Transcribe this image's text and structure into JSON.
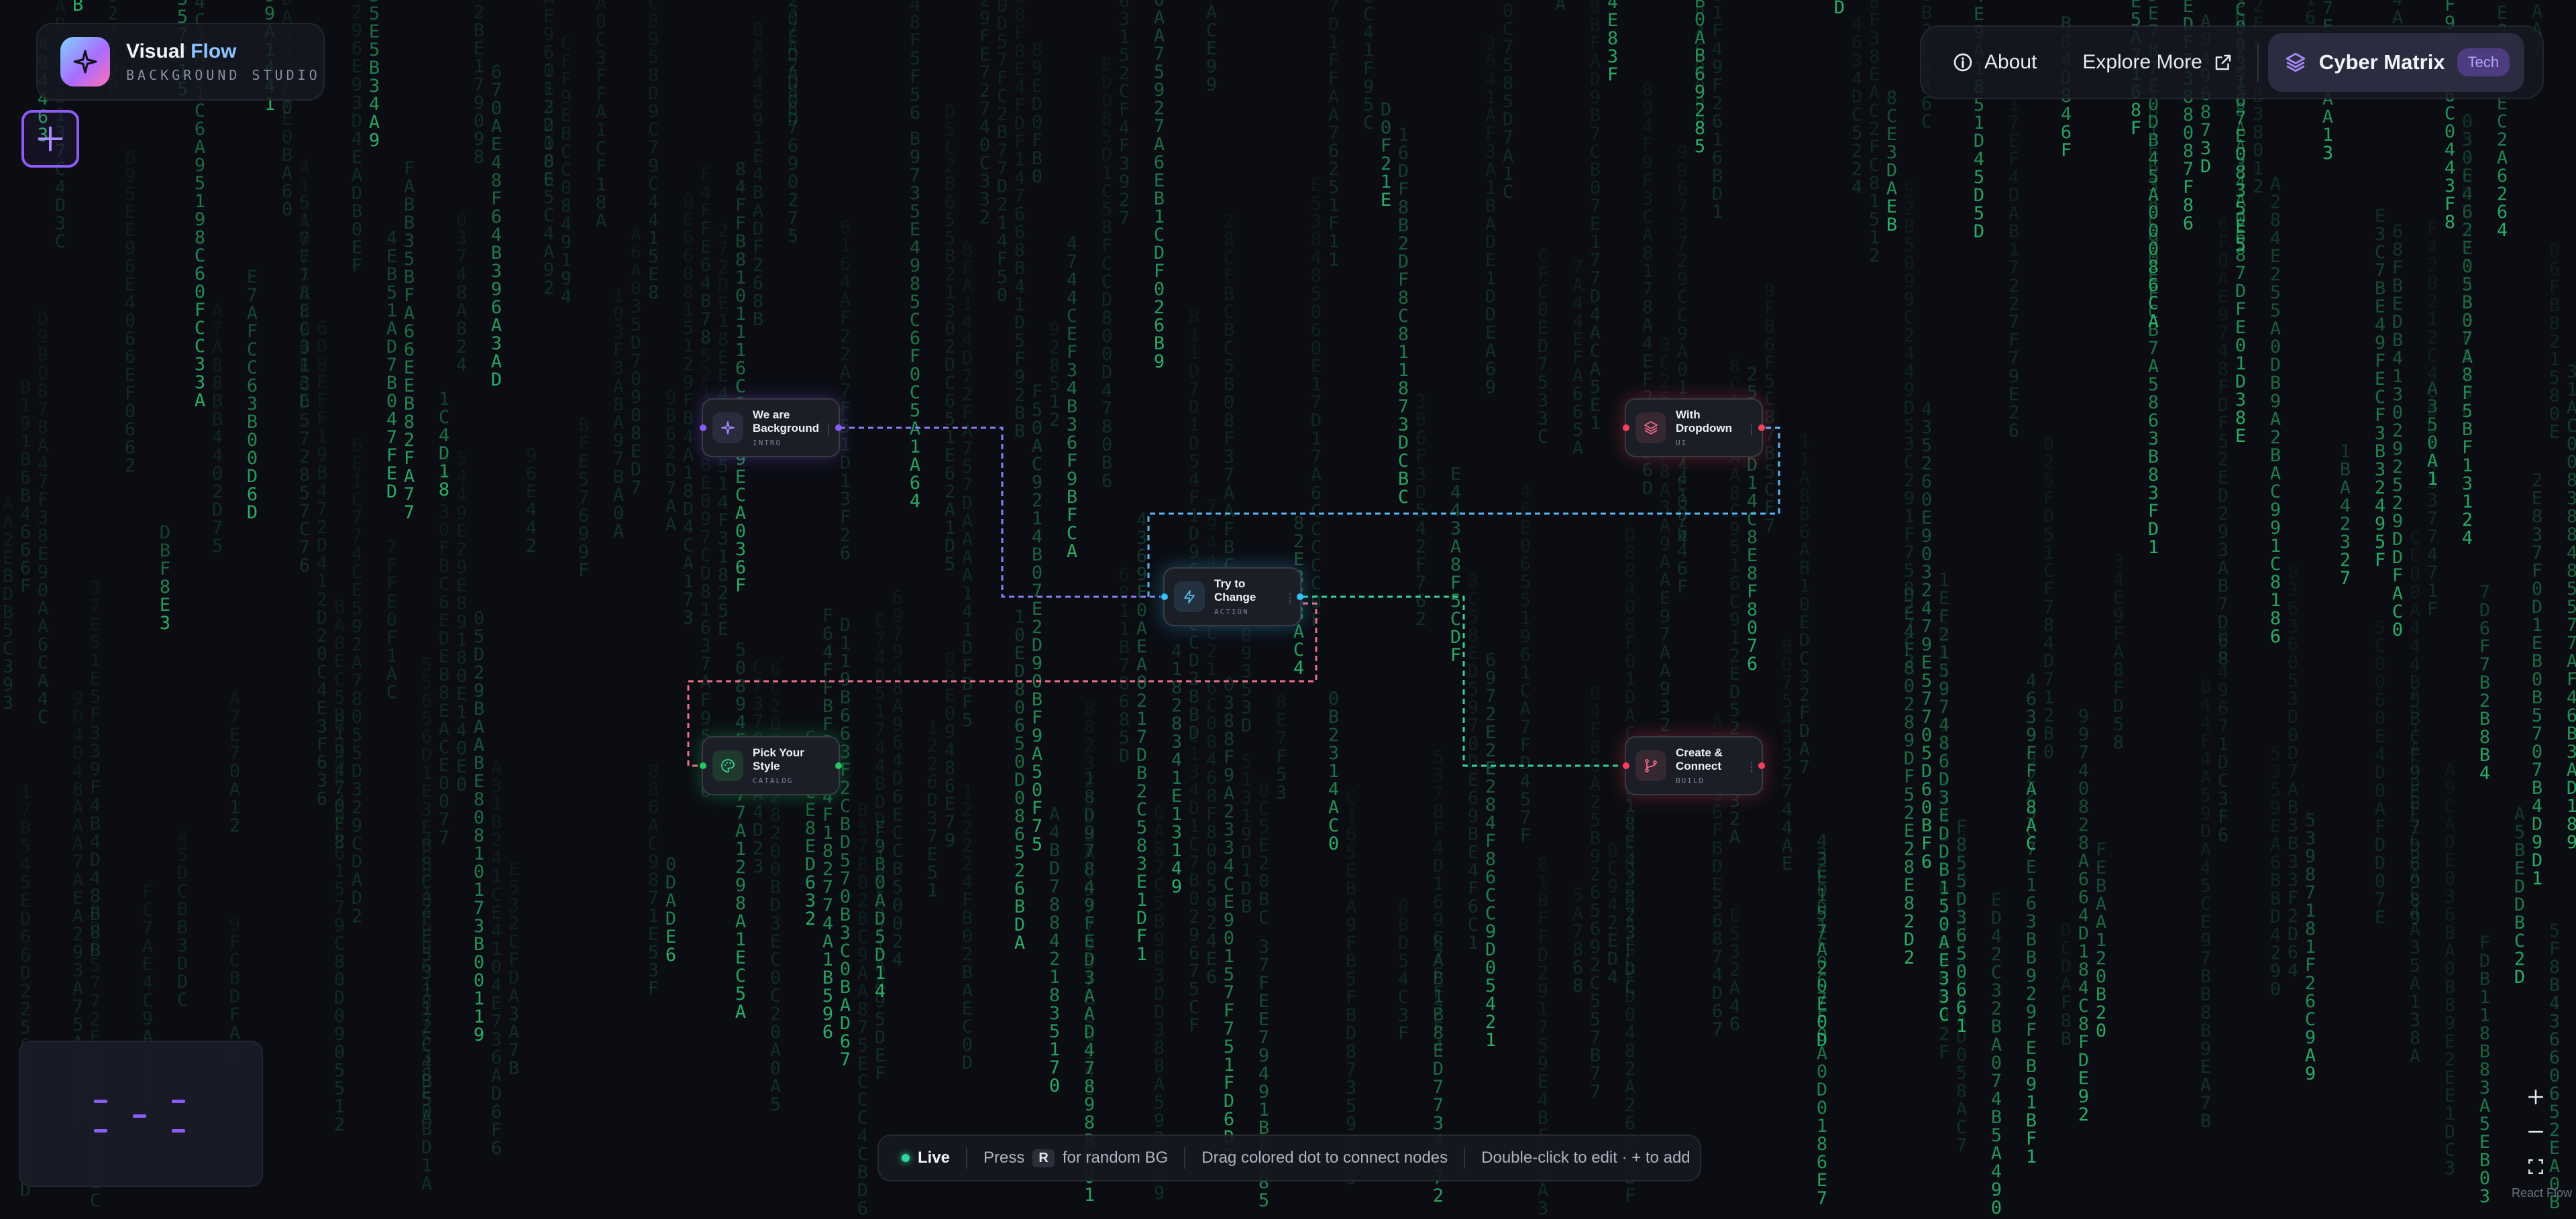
{
  "brand": {
    "title_main": "Visual",
    "title_accent": "Flow",
    "subtitle": "BACKGROUND STUDIO",
    "logo_icon": "sparkle-icon"
  },
  "add_button": {
    "icon": "plus-icon"
  },
  "nav": {
    "about": "About",
    "explore": "Explore More",
    "theme": {
      "label": "Cyber Matrix",
      "badge": "Tech",
      "icon": "layers-icon"
    }
  },
  "nodes": {
    "background": {
      "title": "We are\nBackground",
      "subtitle": "INTRO",
      "color": "#8b5cf6",
      "icon": "sparkle-icon"
    },
    "dropdown": {
      "title": "With\nDropdown",
      "subtitle": "UI",
      "color": "#f43f5e",
      "icon": "layers-icon"
    },
    "change": {
      "title": "Try to\nChange",
      "subtitle": "ACTION",
      "color": "#38bdf8",
      "icon": "bolt-icon"
    },
    "style": {
      "title": "Pick Your\nStyle",
      "subtitle": "CATALOG",
      "color": "#22c55e",
      "icon": "palette-icon"
    },
    "create": {
      "title": "Create &\nConnect",
      "subtitle": "BUILD",
      "color": "#f43f5e",
      "icon": "branch-icon"
    }
  },
  "colors": {
    "accent": "#8b5cf6",
    "matrix": "#2fbf71",
    "edge_purple": "#8b7cf6",
    "edge_blue": "#5ab8f0",
    "edge_green": "#34d399",
    "edge_red": "#f06d8d"
  },
  "status_bar": {
    "live": "Live",
    "press": "Press",
    "key": "R",
    "random_hint": "for random BG",
    "drag_hint": "Drag colored dot to connect nodes",
    "edit_hint": "Double-click to edit · + to add"
  },
  "zoom": {
    "in_icon": "plus-icon",
    "out_icon": "minus-icon",
    "fit_icon": "fit-view-icon"
  },
  "attribution": "React Flow"
}
